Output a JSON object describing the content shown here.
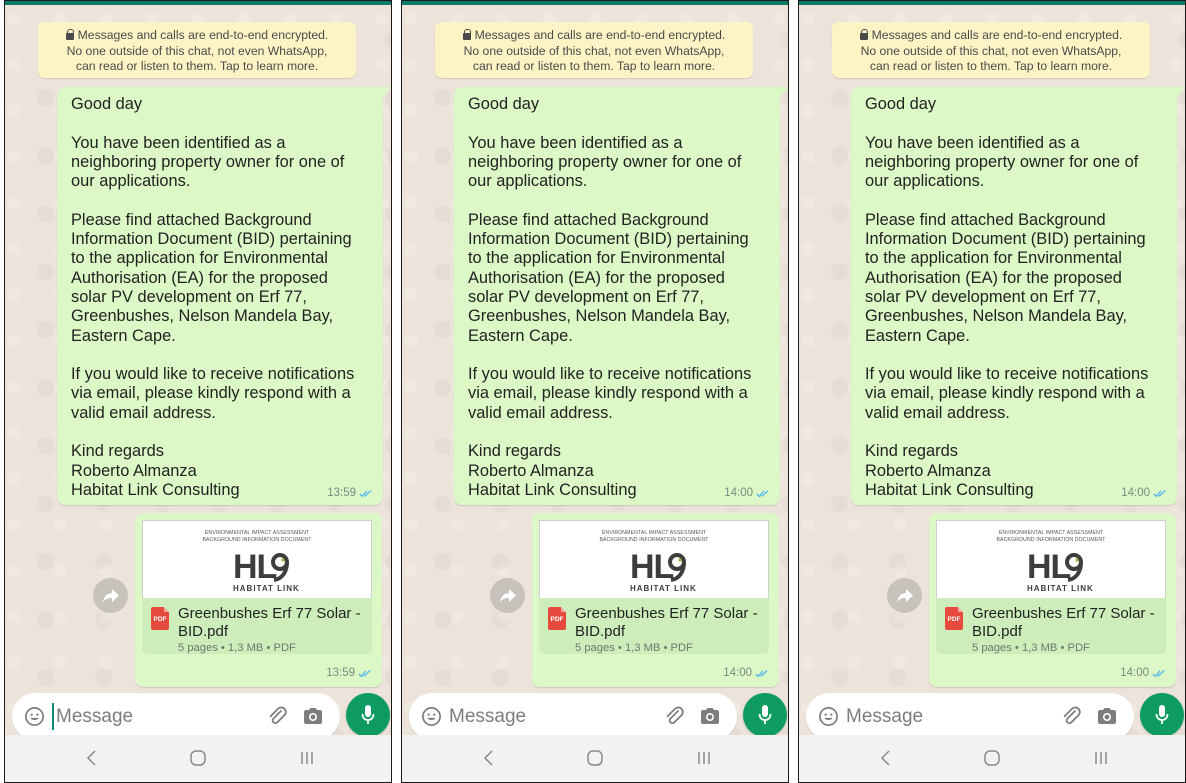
{
  "encryption_notice": {
    "lines": [
      "Messages and calls are end-to-end encrypted.",
      "No one outside of this chat, not even WhatsApp,",
      "can read or listen to them. Tap to learn more."
    ]
  },
  "message": {
    "lines": [
      "Good day",
      "",
      "You have been identified as a",
      "neighboring property owner for one of",
      "our applications.",
      "",
      "Please find attached Background",
      "Information Document (BID) pertaining",
      "to the application for Environmental",
      "Authorisation (EA) for the proposed",
      "solar PV development on Erf 77,",
      "Greenbushes, Nelson Mandela Bay,",
      "Eastern Cape.",
      "",
      "If you would like to receive notifications",
      "via email, please kindly respond with a",
      "valid email address.",
      "",
      "Kind regards",
      "Roberto Almanza",
      "Habitat Link Consulting"
    ]
  },
  "document": {
    "preview_heading_1": "ENVIRONMENTAL IMPACT ASSESSMENT",
    "preview_heading_2": "BACKGROUND INFORMATION DOCUMENT",
    "preview_logo": "HL",
    "preview_logo_sub": "HABITAT LINK",
    "file_icon_label": "PDF",
    "file_name_line1": "Greenbushes Erf 77 Solar -",
    "file_name_line2": "BID.pdf",
    "file_meta": "5 pages • 1,3 MB • PDF"
  },
  "panels": [
    {
      "text_time": "13:59",
      "doc_time": "13:59"
    },
    {
      "text_time": "14:00",
      "doc_time": "14:00"
    },
    {
      "text_time": "14:00",
      "doc_time": "14:00"
    }
  ],
  "input": {
    "placeholder": "Message"
  },
  "icons": {
    "lock": "lock-icon",
    "read_receipt": "double-check-icon",
    "forward": "forward-icon",
    "emoji": "emoji-icon",
    "attach": "paperclip-icon",
    "camera": "camera-icon",
    "mic": "microphone-icon",
    "nav": [
      "back-icon",
      "home-icon",
      "recents-icon"
    ]
  },
  "colors": {
    "header": "#0b7a67",
    "wallpaper": "#ece4da",
    "outgoing_bubble": "#dcf8c6",
    "document_info": "#cdeebb",
    "encryption_banner": "#fdf4c6",
    "read_receipt": "#4fb6ec",
    "mic_button": "#0d9b62",
    "pdf_icon": "#e54a3c"
  }
}
